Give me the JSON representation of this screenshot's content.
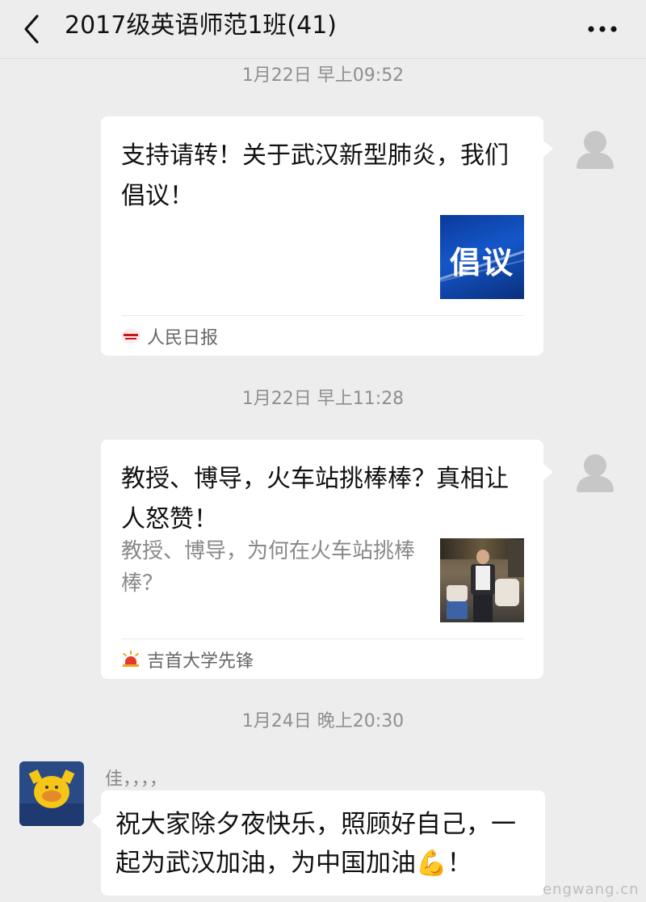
{
  "header": {
    "title": "2017级英语师范1班(41)",
    "back_icon": "chevron-left-icon",
    "more_icon": "more-dots-icon"
  },
  "messages": [
    {
      "timestamp": "1月22日 早上09:52",
      "card": {
        "title": "支持请转！关于武汉新型肺炎，我们倡议！",
        "thumbnail_text": "倡议",
        "source": "人民日报"
      }
    },
    {
      "timestamp": "1月22日 早上11:28",
      "card": {
        "title": "教授、博导，火车站挑棒棒？真相让人怒赞！",
        "description": "教授、博导，为何在火车站挑棒棒？",
        "source": "吉首大学先锋"
      }
    },
    {
      "timestamp": "1月24日 晚上20:30",
      "sender": "佳，，，，",
      "text": "祝大家除夕夜快乐，照顾好自己，一起为武汉加油，为中国加油💪！"
    }
  ],
  "watermark": "engwang.cn",
  "colors": {
    "background": "#ededed",
    "bubble": "#ffffff",
    "timestamp": "#8f8f8f",
    "source_text": "#666666"
  }
}
